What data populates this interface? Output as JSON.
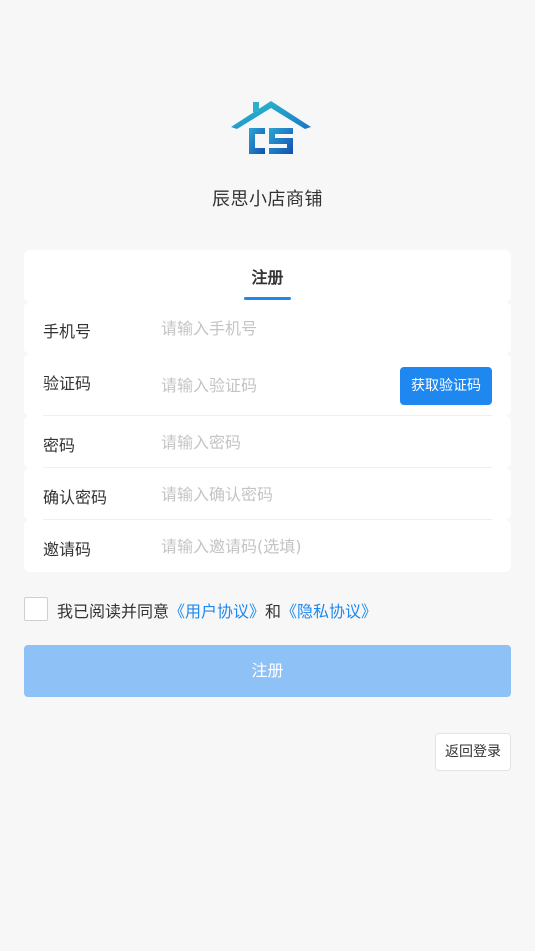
{
  "app": {
    "name": "辰思小店商铺"
  },
  "tabs": {
    "active_label": "注册"
  },
  "form": {
    "phone": {
      "label": "手机号",
      "placeholder": "请输入手机号",
      "value": ""
    },
    "code": {
      "label": "验证码",
      "placeholder": "请输入验证码",
      "value": "",
      "button_label": "获取验证码"
    },
    "password": {
      "label": "密码",
      "placeholder": "请输入密码",
      "value": ""
    },
    "confirm_password": {
      "label": "确认密码",
      "placeholder": "请输入确认密码",
      "value": ""
    },
    "invite": {
      "label": "邀请码",
      "placeholder": "请输入邀请码(选填)",
      "value": ""
    }
  },
  "agreement": {
    "checked": false,
    "prefix": "我已阅读并同意",
    "user_agreement": "《用户协议》",
    "conjunction": "和",
    "privacy_policy": "《隐私协议》"
  },
  "actions": {
    "submit_label": "注册",
    "back_login_label": "返回登录"
  },
  "colors": {
    "accent": "#1e88f0",
    "accent_disabled": "#8ec2f7",
    "background": "#f7f7f7",
    "logo_teal": "#29b6c6",
    "logo_blue": "#1565c0"
  },
  "icons": {
    "logo": "cs-house-logo",
    "checkbox": "checkbox-unchecked"
  }
}
